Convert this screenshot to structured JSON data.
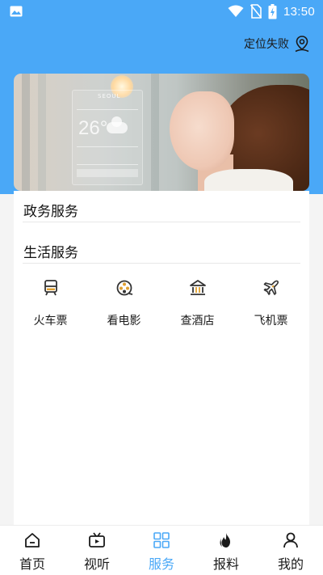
{
  "status_bar": {
    "time": "13:50",
    "icons": [
      "gallery-icon",
      "wifi-icon",
      "no-sim-icon",
      "battery-charging-icon"
    ]
  },
  "header": {
    "location_text": "定位失败",
    "location_icon": "location-pin-icon"
  },
  "banner": {
    "weather_temp": "26°",
    "weather_city": "SEOUL"
  },
  "sections": {
    "government": {
      "title": "政务服务"
    },
    "life": {
      "title": "生活服务",
      "items": [
        {
          "label": "火车票",
          "icon": "train-icon"
        },
        {
          "label": "看电影",
          "icon": "film-reel-icon"
        },
        {
          "label": "查酒店",
          "icon": "hotel-icon"
        },
        {
          "label": "飞机票",
          "icon": "airplane-icon"
        }
      ]
    }
  },
  "tabbar": {
    "active_index": 2,
    "accent_color": "#4aa8f7",
    "tabs": [
      {
        "label": "首页",
        "icon": "home-icon"
      },
      {
        "label": "视听",
        "icon": "tv-icon"
      },
      {
        "label": "服务",
        "icon": "grid-icon"
      },
      {
        "label": "报料",
        "icon": "flame-icon"
      },
      {
        "label": "我的",
        "icon": "user-icon"
      }
    ]
  },
  "colors": {
    "header_bg": "#4aa8f7",
    "page_bg": "#f4f4f4",
    "card_bg": "#ffffff"
  }
}
